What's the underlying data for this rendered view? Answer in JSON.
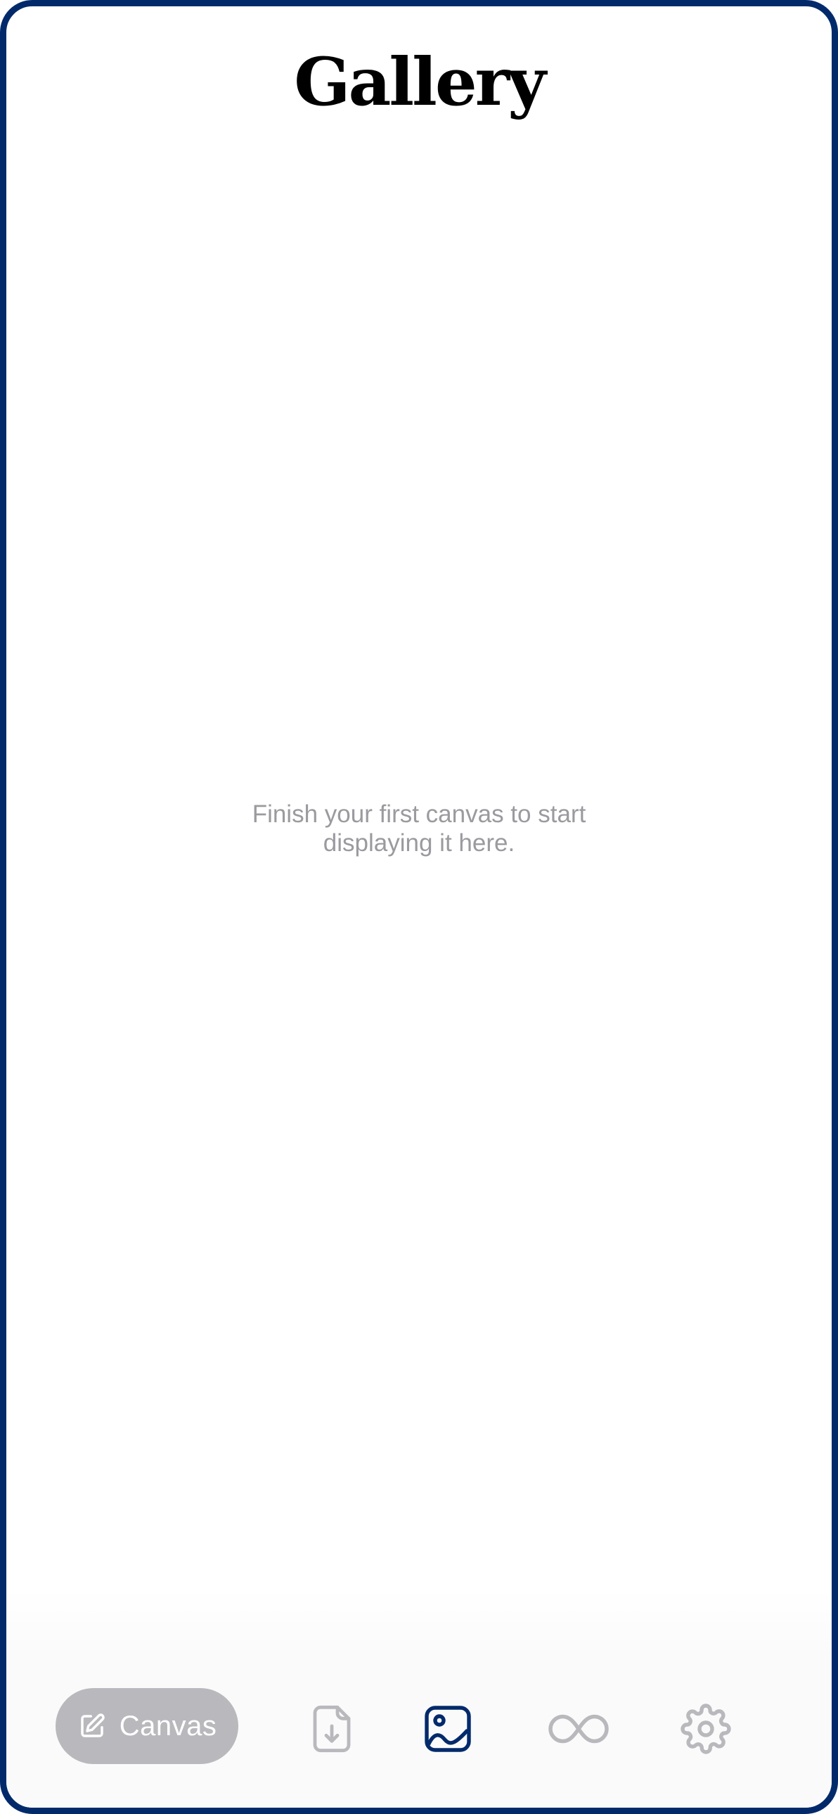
{
  "header": {
    "title": "Gallery"
  },
  "main": {
    "empty_state_line1": "Finish your first canvas to start",
    "empty_state_line2": "displaying it here."
  },
  "tab_bar": {
    "canvas_button_label": "Canvas",
    "icons": [
      "pencil-square-icon",
      "file-download-icon",
      "image-icon",
      "infinity-icon",
      "gear-icon"
    ],
    "active_tab": "image-icon"
  },
  "colors": {
    "frame": "#022a6b",
    "active_icon": "#022a6b",
    "inactive_icon": "#b9b8bd",
    "canvas_button_bg": "#b9b8bd",
    "empty_text": "#9a9a9f"
  }
}
